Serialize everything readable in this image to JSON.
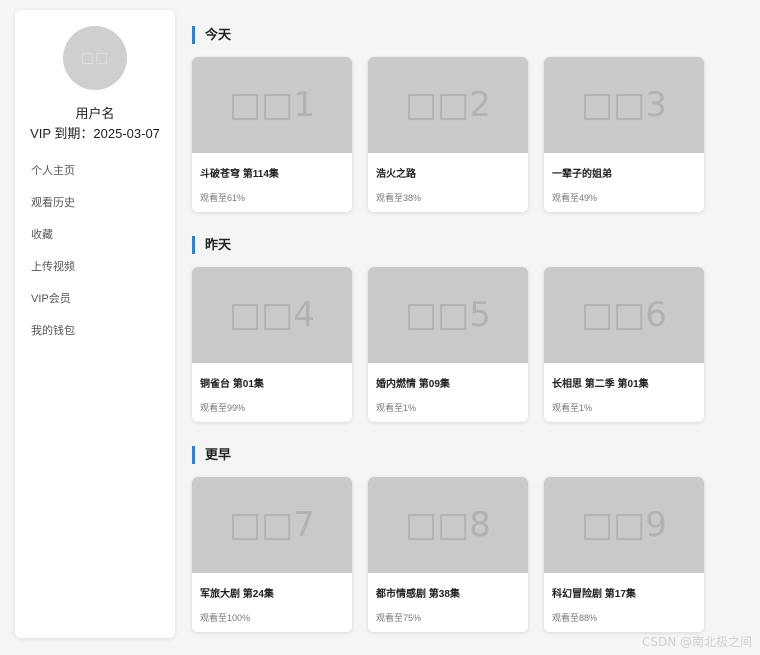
{
  "sidebar": {
    "avatar_placeholder": "□□",
    "username": "用户名",
    "vip_expiry": "VIP 到期：2025-03-07",
    "nav": [
      {
        "label": "个人主页"
      },
      {
        "label": "观看历史"
      },
      {
        "label": "收藏"
      },
      {
        "label": "上传视频"
      },
      {
        "label": "VIP会员"
      },
      {
        "label": "我的钱包"
      }
    ]
  },
  "sections": [
    {
      "title": "今天",
      "items": [
        {
          "thumb": "□□1",
          "title": "斗破苍穹 第114集",
          "progress": "观看至61%"
        },
        {
          "thumb": "□□2",
          "title": "浩火之路",
          "progress": "观看至38%"
        },
        {
          "thumb": "□□3",
          "title": "一辈子的姐弟",
          "progress": "观看至49%"
        }
      ]
    },
    {
      "title": "昨天",
      "items": [
        {
          "thumb": "□□4",
          "title": "铜雀台 第01集",
          "progress": "观看至99%"
        },
        {
          "thumb": "□□5",
          "title": "婚内燃情 第09集",
          "progress": "观看至1%"
        },
        {
          "thumb": "□□6",
          "title": "长相思 第二季 第01集",
          "progress": "观看至1%"
        }
      ]
    },
    {
      "title": "更早",
      "items": [
        {
          "thumb": "□□7",
          "title": "军旅大剧 第24集",
          "progress": "观看至100%"
        },
        {
          "thumb": "□□8",
          "title": "都市情感剧 第38集",
          "progress": "观看至75%"
        },
        {
          "thumb": "□□9",
          "title": "科幻冒险剧 第17集",
          "progress": "观看至88%"
        }
      ]
    }
  ],
  "watermark": "CSDN @南北极之间",
  "colors": {
    "accent": "#2f7de1",
    "thumb_bg": "#c9c9c9",
    "page_bg": "#f5f5f5"
  }
}
